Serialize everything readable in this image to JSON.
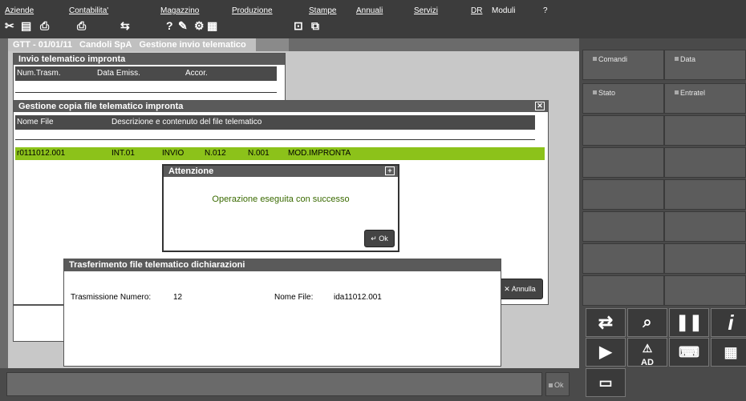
{
  "menu": {
    "items": [
      "Aziende",
      "Contabilita'",
      "Magazzino",
      "Produzione",
      "Stampe",
      "Annuali",
      "Servizi",
      "DR",
      "Moduli",
      "?"
    ]
  },
  "toolbar": {
    "icons": [
      "scissors-icon",
      "document-icon",
      "printer-out-icon",
      "printer-icon",
      "arrows-icon",
      "help-icon",
      "calc-icon",
      "tree-icon",
      "grid-icon",
      "maximize-icon",
      "restore-icon"
    ]
  },
  "breadcrumb": {
    "items": [
      "GTT - 01/01/11",
      "Candoli SpA",
      "Gestione invio telematico"
    ]
  },
  "invio_window": {
    "title": "Invio telematico impronta",
    "headers": [
      "Num.Trasm.",
      "Data Emiss.",
      "Accor."
    ]
  },
  "gestione_window": {
    "title": "Gestione copia file telematico impronta",
    "headers": [
      "Nome File",
      "Descrizione e contenuto del file telematico"
    ],
    "row": [
      "r0111012.001",
      "INT.01",
      "INVIO",
      "N.012",
      "N.001",
      "MOD.IMPRONTA"
    ],
    "annulla_label": "Annulla"
  },
  "alert": {
    "title": "Attenzione",
    "message": "Operazione eseguita con successo",
    "ok_label": "Ok"
  },
  "transfer": {
    "title": "Trasferimento file telematico dichiarazioni",
    "trasmissione_label": "Trasmissione Numero:",
    "trasmissione_value": "12",
    "nome_file_label": "Nome File:",
    "nome_file_value": "ida11012.001"
  },
  "right_panel": {
    "buttons": [
      "Comandi",
      "Data",
      "Stato",
      "Entratel"
    ]
  },
  "bottom": {
    "ok_label": "Ok"
  },
  "ad_label": "AD"
}
